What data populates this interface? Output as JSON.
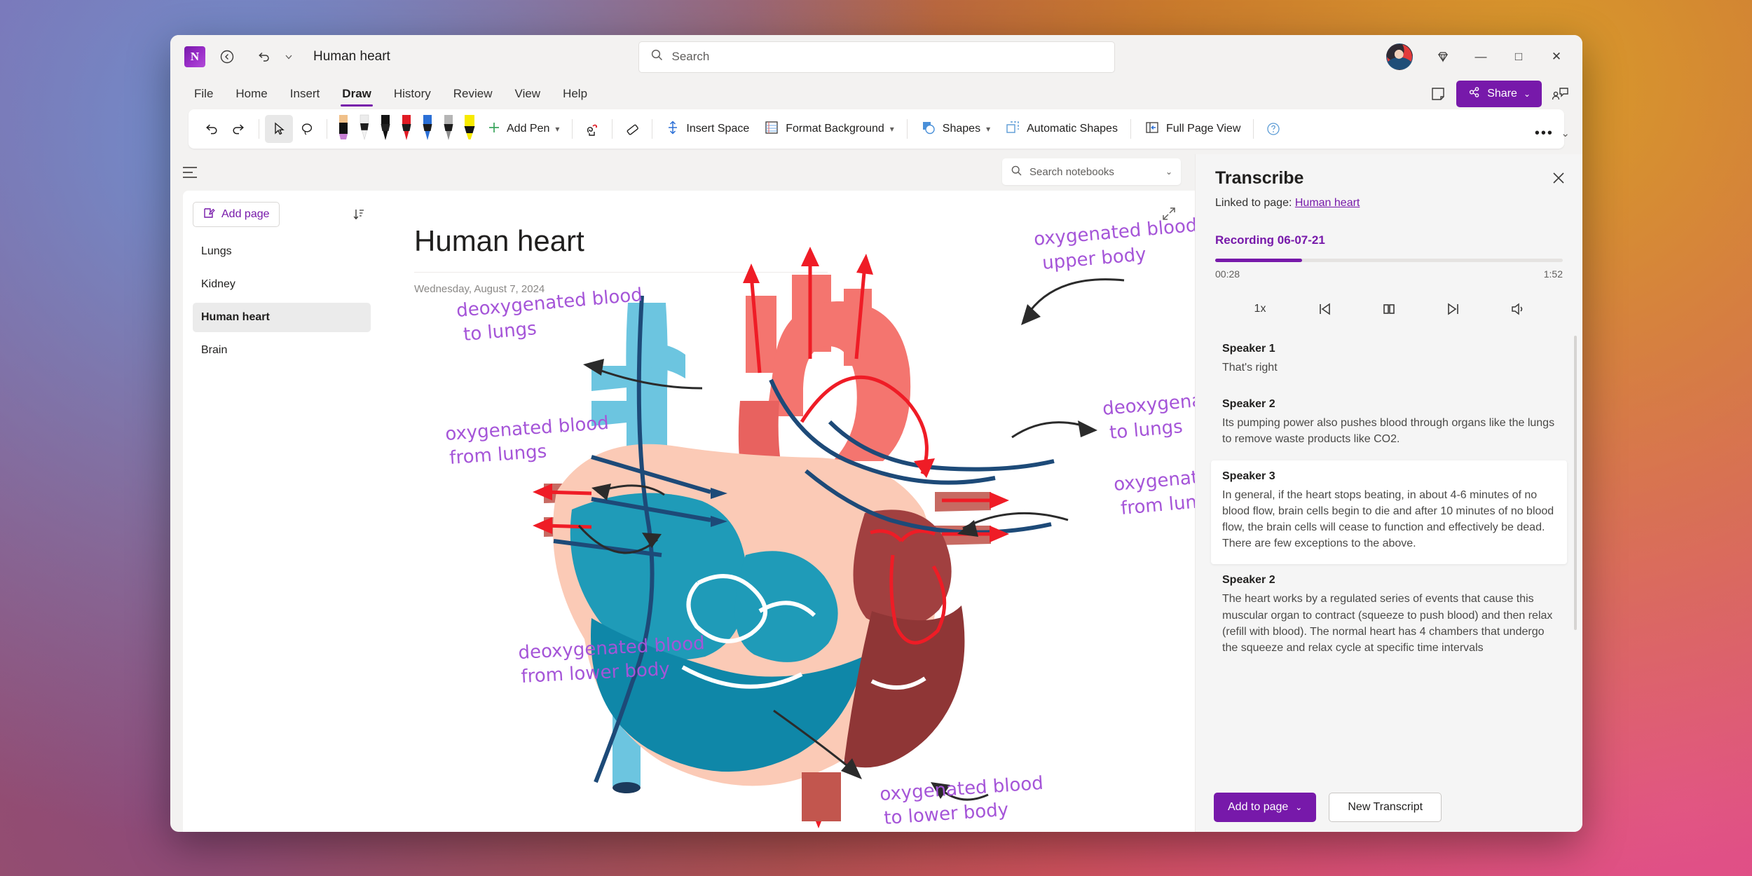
{
  "titlebar": {
    "app_logo": "N",
    "doc_title": "Human heart",
    "back_icon": "back-circle-icon",
    "undo_icon": "undo-icon",
    "caret_icon": "caret-down-icon",
    "search_placeholder": "Search",
    "search_icon": "search-icon",
    "diamond_icon": "diamond-icon",
    "minimize": "—",
    "maximize": "□",
    "close": "✕"
  },
  "menubar": {
    "items": [
      {
        "label": "File",
        "active": false
      },
      {
        "label": "Home",
        "active": false
      },
      {
        "label": "Insert",
        "active": false
      },
      {
        "label": "Draw",
        "active": true
      },
      {
        "label": "History",
        "active": false
      },
      {
        "label": "Review",
        "active": false
      },
      {
        "label": "View",
        "active": false
      },
      {
        "label": "Help",
        "active": false
      }
    ],
    "note_icon": "sticky-note-icon",
    "share_label": "Share",
    "share_chevron": "⌄",
    "share_color": "#7719aa",
    "people_icon": "add-collaborator-icon"
  },
  "ribbon": {
    "undo": "undo-icon",
    "redo": "redo-icon",
    "select": "select-cursor-icon",
    "lasso": "lasso-select-icon",
    "pens": [
      {
        "name": "pen-tan",
        "body": "#000000",
        "tip": "#c77fd4",
        "cap": "#f0c089"
      },
      {
        "name": "pen-white",
        "body": "#ffffff",
        "tip": "#2b2b2b",
        "cap": "#e6e6e6"
      },
      {
        "name": "pen-black",
        "body": "#1a1a1a",
        "tip": "#111111",
        "cap": "#333333"
      },
      {
        "name": "pen-red",
        "body": "#1a1a1a",
        "tip": "#e01b24",
        "cap": "#e01b24"
      },
      {
        "name": "pen-blue",
        "body": "#1a1a1a",
        "tip": "#2a6fd6",
        "cap": "#2a6fd6"
      },
      {
        "name": "pen-grey",
        "body": "#1a1a1a",
        "tip": "#9a9a9a",
        "cap": "#b5b5b5"
      },
      {
        "name": "highlighter-yellow",
        "body": "#f7ea00",
        "tip": "#d9cf00",
        "cap": "#f7ea00"
      }
    ],
    "add_pen_label": "Add Pen",
    "add_pen_icon": "plus-icon",
    "ink_to_shape_icon": "ink-gesture-icon",
    "eraser_icon": "eraser-icon",
    "insert_space_label": "Insert Space",
    "insert_space_icon": "insert-space-icon",
    "format_background_label": "Format Background",
    "format_background_icon": "format-background-icon",
    "shapes_label": "Shapes",
    "shapes_icon": "shapes-icon",
    "automatic_shapes_label": "Automatic Shapes",
    "automatic_shapes_icon": "automatic-shapes-icon",
    "full_page_view_label": "Full Page View",
    "full_page_view_icon": "full-page-view-icon",
    "help_icon": "help-circle-icon",
    "overflow": "•••",
    "collapse_chevron": "⌄"
  },
  "nav": {
    "hamburger": "hamburger-menu-icon",
    "search_notebooks_placeholder": "Search notebooks",
    "search_icon": "search-icon",
    "chevron": "⌄"
  },
  "pagelist": {
    "add_page_label": "Add page",
    "add_page_icon": "new-page-icon",
    "sort_icon": "sort-icon",
    "pages": [
      {
        "label": "Lungs",
        "selected": false
      },
      {
        "label": "Kidney",
        "selected": false
      },
      {
        "label": "Human heart",
        "selected": true
      },
      {
        "label": "Brain",
        "selected": false
      }
    ]
  },
  "page": {
    "title": "Human heart",
    "date": "Wednesday, August 7, 2024",
    "expand_icon": "expand-diagonal-icon",
    "annotations": [
      {
        "id": "ann-oxy-upper-body",
        "line1": "oxygenated blood to",
        "line2": "upper body"
      },
      {
        "id": "ann-deoxy-to-lungs-left",
        "line1": "deoxygenated blood",
        "line2": "to lungs"
      },
      {
        "id": "ann-oxy-from-lungs-left",
        "line1": "oxygenated blood",
        "line2": "from lungs"
      },
      {
        "id": "ann-deoxy-to-lungs-right",
        "line1": "deoxygenated blood",
        "line2": "to lungs"
      },
      {
        "id": "ann-oxy-from-lungs-right",
        "line1": "oxygenated blood",
        "line2": "from lungs"
      },
      {
        "id": "ann-deoxy-lower-body",
        "line1": "deoxygenated blood",
        "line2": "from lower body"
      },
      {
        "id": "ann-oxy-lower-body",
        "line1": "oxygenated blood",
        "line2": "to lower body"
      }
    ],
    "ink_color": "#a555d8"
  },
  "transcribe": {
    "title": "Transcribe",
    "close_icon": "close-icon",
    "linked_prefix": "Linked to page:",
    "linked_page": "Human heart",
    "recording_name": "Recording 06-07-21",
    "progress_percent": 25,
    "time_current": "00:28",
    "time_total": "1:52",
    "controls": [
      {
        "name": "playback-speed-button",
        "glyph": "1x"
      },
      {
        "name": "previous-button",
        "glyph": "prev"
      },
      {
        "name": "pause-button",
        "glyph": "pause"
      },
      {
        "name": "next-button",
        "glyph": "next"
      },
      {
        "name": "volume-button",
        "glyph": "volume"
      }
    ],
    "entries": [
      {
        "speaker": "Speaker 1",
        "text": "That's right",
        "highlighted": false
      },
      {
        "speaker": "Speaker 2",
        "text": "Its pumping power also pushes blood through organs like the lungs to remove waste products like CO2.",
        "highlighted": false
      },
      {
        "speaker": "Speaker 3",
        "text": "In general, if the heart stops beating, in about 4-6 minutes of no blood flow, brain cells begin to die and after 10 minutes of no blood flow, the brain cells will cease to function and effectively be dead. There are few exceptions to the above.",
        "highlighted": true
      },
      {
        "speaker": "Speaker 2",
        "text": "The heart works by a regulated series of events that cause this muscular organ to contract (squeeze to push blood) and then relax (refill with blood). The normal heart has 4 chambers that undergo the squeeze and relax cycle at specific time intervals",
        "highlighted": false
      }
    ],
    "add_to_page_label": "Add to page",
    "add_to_page_chevron": "⌄",
    "new_transcript_label": "New Transcript",
    "accent_color": "#7719aa"
  }
}
